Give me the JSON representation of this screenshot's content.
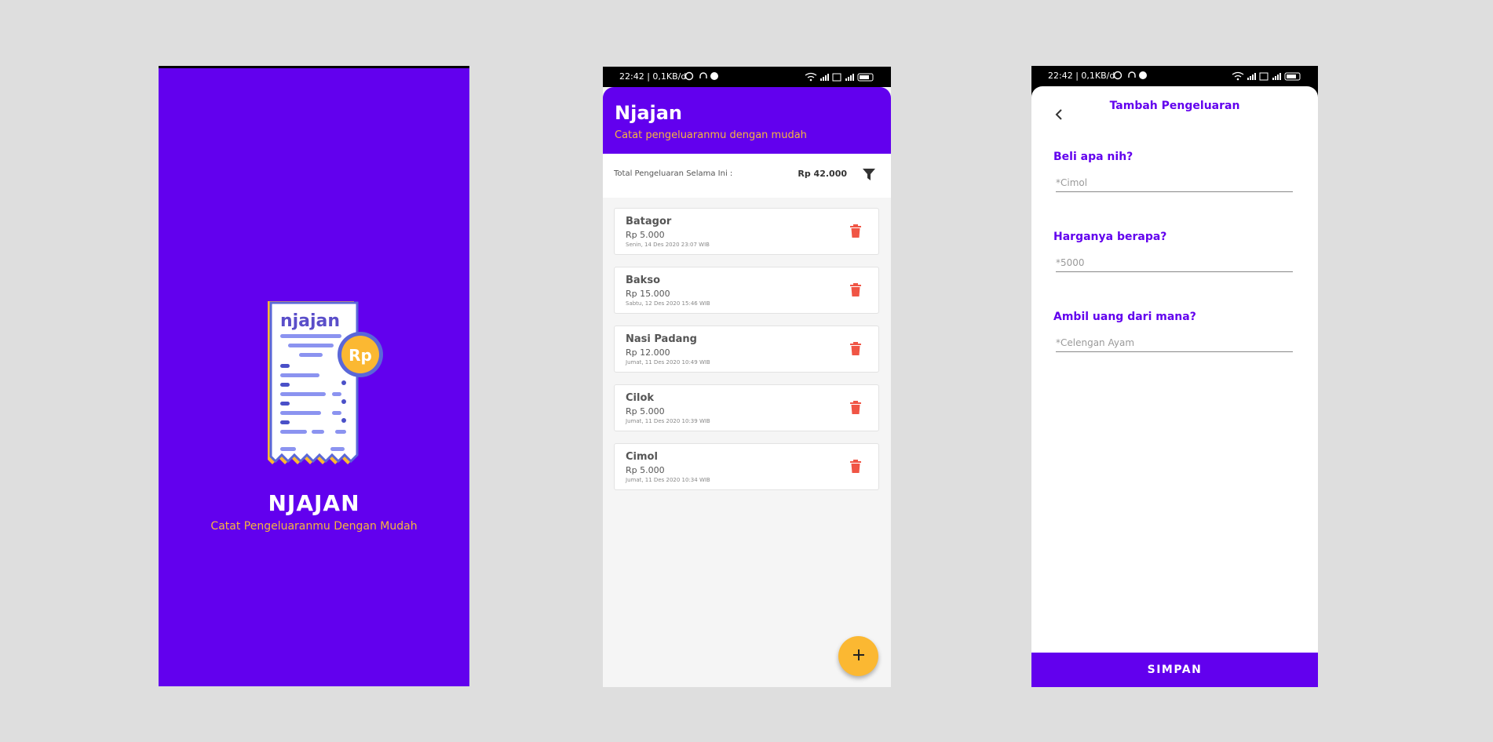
{
  "splash": {
    "logo_text": "njajan",
    "coin_text": "Rp",
    "app_name": "NJAJAN",
    "tagline": "Catat Pengeluaranmu Dengan Mudah"
  },
  "statusbar": {
    "time": "22:42 | 0,1KB/d"
  },
  "list": {
    "title": "Njajan",
    "subtitle": "Catat pengeluaranmu dengan mudah",
    "total_label": "Total Pengeluaran Selama Ini :",
    "total_value": "Rp 42.000",
    "items": [
      {
        "name": "Batagor",
        "price": "Rp 5.000",
        "date": "Senin, 14 Des 2020 23:07 WIB"
      },
      {
        "name": "Bakso",
        "price": "Rp 15.000",
        "date": "Sabtu, 12 Des 2020 15:46 WIB"
      },
      {
        "name": "Nasi Padang",
        "price": "Rp 12.000",
        "date": "Jumat, 11 Des 2020 10:49 WIB"
      },
      {
        "name": "Cilok",
        "price": "Rp 5.000",
        "date": "Jumat, 11 Des 2020 10:39 WIB"
      },
      {
        "name": "Cimol",
        "price": "Rp 5.000",
        "date": "Jumat, 11 Des 2020 10:34 WIB"
      }
    ],
    "fab_icon": "plus-icon"
  },
  "form": {
    "title": "Tambah Pengeluaran",
    "fields": [
      {
        "label": "Beli apa nih?",
        "placeholder": "*Cimol"
      },
      {
        "label": "Harganya berapa?",
        "placeholder": "*5000"
      },
      {
        "label": "Ambil uang dari mana?",
        "placeholder": "*Celengan Ayam"
      }
    ],
    "save_label": "SIMPAN"
  },
  "colors": {
    "primary": "#6200ee",
    "accent": "#f6b73c",
    "fab": "#fbb832",
    "delete": "#f05545",
    "background": "#dedede"
  }
}
